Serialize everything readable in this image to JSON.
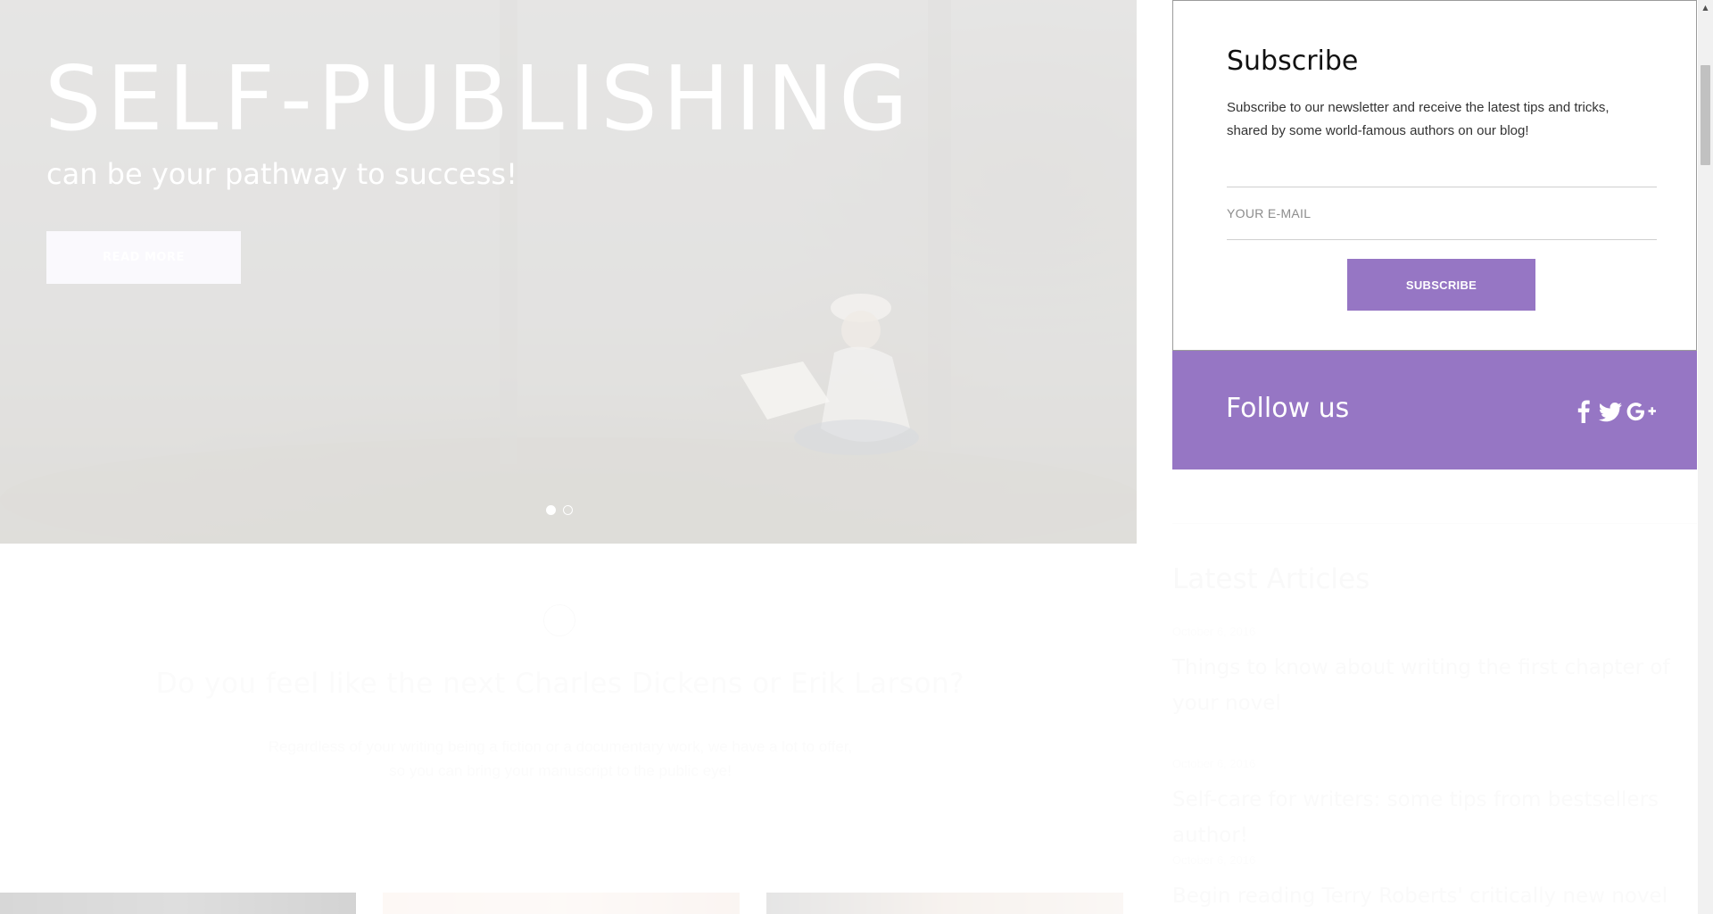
{
  "hero": {
    "title": "SELF-PUBLISHING",
    "subtitle": "can be your pathway to success!",
    "button_label": "READ MORE",
    "slider": {
      "count": 2,
      "active": 1
    }
  },
  "intro": {
    "icon": "pen-nib-icon",
    "title": "Do you feel like the next Charles Dickens or Erik Larson?",
    "text_line1": "Regardless of your writing being a fiction or a documentary work, we have a lot to offer,",
    "text_line2": "so you can bring your manuscript to the public eye!"
  },
  "subscribe": {
    "title": "Subscribe",
    "text": "Subscribe to our newsletter and receive the latest tips and tricks, shared by some world-famous authors on our blog!",
    "email_placeholder": "YOUR E-MAIL",
    "email_value": "",
    "button_label": "SUBSCRIBE"
  },
  "follow": {
    "title": "Follow us",
    "icons": [
      "facebook-icon",
      "twitter-icon",
      "google-plus-icon"
    ]
  },
  "latest": {
    "title": "Latest Articles",
    "articles": [
      {
        "date": "October 6, 2016",
        "title": "Things to know about writing the first chapter of your novel"
      },
      {
        "date": "October 6, 2016",
        "title": "Self-care for writers: some tips from bestsellers author!"
      },
      {
        "date": "October 6, 2016",
        "title": "Begin reading Terry Roberts' critically new novel"
      }
    ]
  },
  "colors": {
    "accent": "#9676c4",
    "hero_button": "#e6e3f4"
  }
}
